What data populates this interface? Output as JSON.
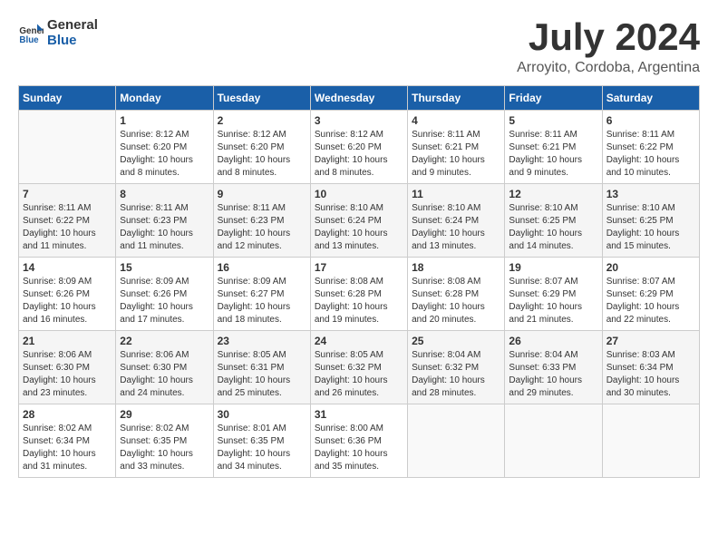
{
  "logo": {
    "general": "General",
    "blue": "Blue"
  },
  "title": {
    "month_year": "July 2024",
    "location": "Arroyito, Cordoba, Argentina"
  },
  "headers": [
    "Sunday",
    "Monday",
    "Tuesday",
    "Wednesday",
    "Thursday",
    "Friday",
    "Saturday"
  ],
  "weeks": [
    [
      {
        "day": "",
        "info": ""
      },
      {
        "day": "1",
        "info": "Sunrise: 8:12 AM\nSunset: 6:20 PM\nDaylight: 10 hours\nand 8 minutes."
      },
      {
        "day": "2",
        "info": "Sunrise: 8:12 AM\nSunset: 6:20 PM\nDaylight: 10 hours\nand 8 minutes."
      },
      {
        "day": "3",
        "info": "Sunrise: 8:12 AM\nSunset: 6:20 PM\nDaylight: 10 hours\nand 8 minutes."
      },
      {
        "day": "4",
        "info": "Sunrise: 8:11 AM\nSunset: 6:21 PM\nDaylight: 10 hours\nand 9 minutes."
      },
      {
        "day": "5",
        "info": "Sunrise: 8:11 AM\nSunset: 6:21 PM\nDaylight: 10 hours\nand 9 minutes."
      },
      {
        "day": "6",
        "info": "Sunrise: 8:11 AM\nSunset: 6:22 PM\nDaylight: 10 hours\nand 10 minutes."
      }
    ],
    [
      {
        "day": "7",
        "info": "Sunrise: 8:11 AM\nSunset: 6:22 PM\nDaylight: 10 hours\nand 11 minutes."
      },
      {
        "day": "8",
        "info": "Sunrise: 8:11 AM\nSunset: 6:23 PM\nDaylight: 10 hours\nand 11 minutes."
      },
      {
        "day": "9",
        "info": "Sunrise: 8:11 AM\nSunset: 6:23 PM\nDaylight: 10 hours\nand 12 minutes."
      },
      {
        "day": "10",
        "info": "Sunrise: 8:10 AM\nSunset: 6:24 PM\nDaylight: 10 hours\nand 13 minutes."
      },
      {
        "day": "11",
        "info": "Sunrise: 8:10 AM\nSunset: 6:24 PM\nDaylight: 10 hours\nand 13 minutes."
      },
      {
        "day": "12",
        "info": "Sunrise: 8:10 AM\nSunset: 6:25 PM\nDaylight: 10 hours\nand 14 minutes."
      },
      {
        "day": "13",
        "info": "Sunrise: 8:10 AM\nSunset: 6:25 PM\nDaylight: 10 hours\nand 15 minutes."
      }
    ],
    [
      {
        "day": "14",
        "info": "Sunrise: 8:09 AM\nSunset: 6:26 PM\nDaylight: 10 hours\nand 16 minutes."
      },
      {
        "day": "15",
        "info": "Sunrise: 8:09 AM\nSunset: 6:26 PM\nDaylight: 10 hours\nand 17 minutes."
      },
      {
        "day": "16",
        "info": "Sunrise: 8:09 AM\nSunset: 6:27 PM\nDaylight: 10 hours\nand 18 minutes."
      },
      {
        "day": "17",
        "info": "Sunrise: 8:08 AM\nSunset: 6:28 PM\nDaylight: 10 hours\nand 19 minutes."
      },
      {
        "day": "18",
        "info": "Sunrise: 8:08 AM\nSunset: 6:28 PM\nDaylight: 10 hours\nand 20 minutes."
      },
      {
        "day": "19",
        "info": "Sunrise: 8:07 AM\nSunset: 6:29 PM\nDaylight: 10 hours\nand 21 minutes."
      },
      {
        "day": "20",
        "info": "Sunrise: 8:07 AM\nSunset: 6:29 PM\nDaylight: 10 hours\nand 22 minutes."
      }
    ],
    [
      {
        "day": "21",
        "info": "Sunrise: 8:06 AM\nSunset: 6:30 PM\nDaylight: 10 hours\nand 23 minutes."
      },
      {
        "day": "22",
        "info": "Sunrise: 8:06 AM\nSunset: 6:30 PM\nDaylight: 10 hours\nand 24 minutes."
      },
      {
        "day": "23",
        "info": "Sunrise: 8:05 AM\nSunset: 6:31 PM\nDaylight: 10 hours\nand 25 minutes."
      },
      {
        "day": "24",
        "info": "Sunrise: 8:05 AM\nSunset: 6:32 PM\nDaylight: 10 hours\nand 26 minutes."
      },
      {
        "day": "25",
        "info": "Sunrise: 8:04 AM\nSunset: 6:32 PM\nDaylight: 10 hours\nand 28 minutes."
      },
      {
        "day": "26",
        "info": "Sunrise: 8:04 AM\nSunset: 6:33 PM\nDaylight: 10 hours\nand 29 minutes."
      },
      {
        "day": "27",
        "info": "Sunrise: 8:03 AM\nSunset: 6:34 PM\nDaylight: 10 hours\nand 30 minutes."
      }
    ],
    [
      {
        "day": "28",
        "info": "Sunrise: 8:02 AM\nSunset: 6:34 PM\nDaylight: 10 hours\nand 31 minutes."
      },
      {
        "day": "29",
        "info": "Sunrise: 8:02 AM\nSunset: 6:35 PM\nDaylight: 10 hours\nand 33 minutes."
      },
      {
        "day": "30",
        "info": "Sunrise: 8:01 AM\nSunset: 6:35 PM\nDaylight: 10 hours\nand 34 minutes."
      },
      {
        "day": "31",
        "info": "Sunrise: 8:00 AM\nSunset: 6:36 PM\nDaylight: 10 hours\nand 35 minutes."
      },
      {
        "day": "",
        "info": ""
      },
      {
        "day": "",
        "info": ""
      },
      {
        "day": "",
        "info": ""
      }
    ]
  ]
}
